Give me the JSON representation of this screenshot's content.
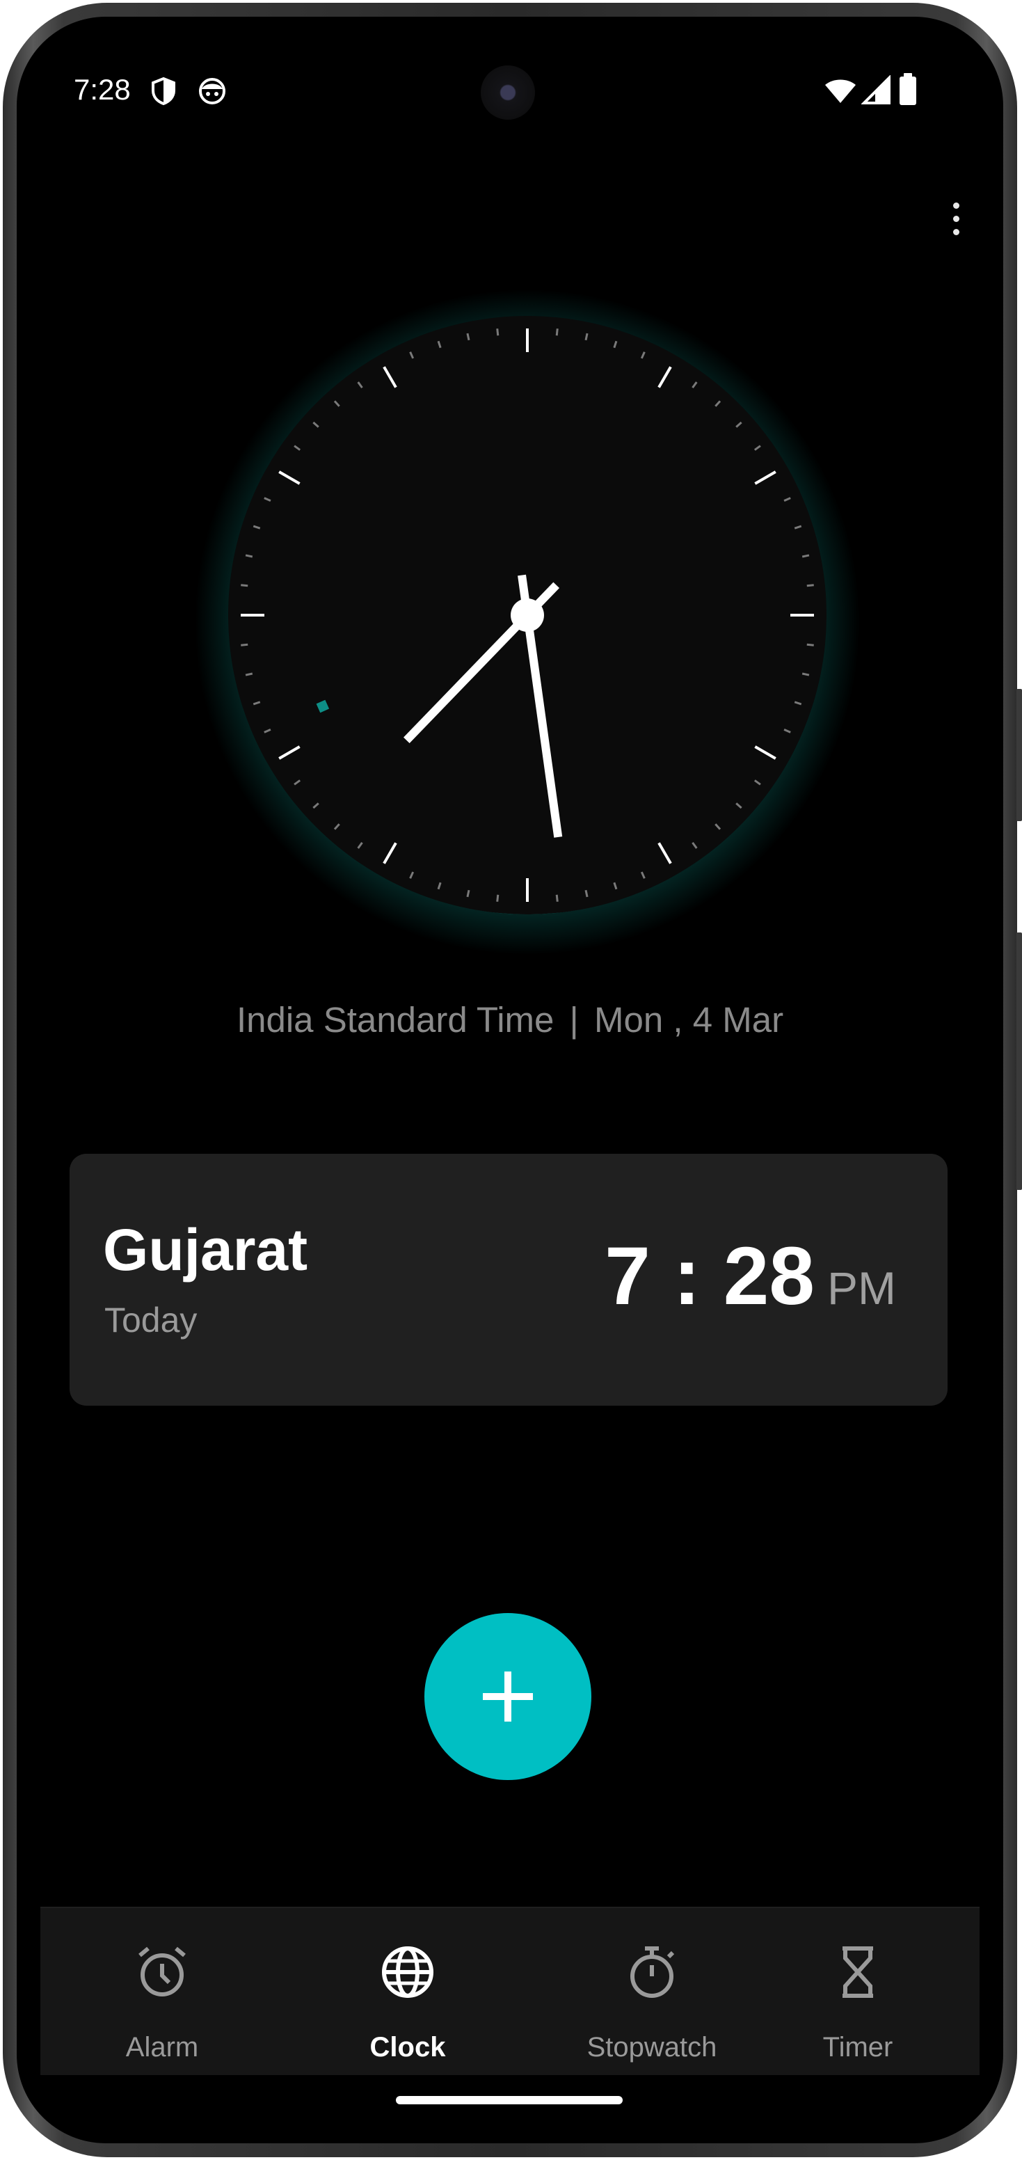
{
  "status_bar": {
    "time": "7:28",
    "left_icons": [
      "shield-icon",
      "face-icon"
    ],
    "right_icons": [
      "wifi-icon",
      "cellular-signal-icon",
      "battery-icon"
    ]
  },
  "toolbar": {
    "menu_icon": "more-vert-icon"
  },
  "analog_clock": {
    "hour": 7,
    "minute": 28,
    "second": 41,
    "accent_color": "#0e8e86"
  },
  "timezone_line": {
    "zone": "India Standard Time",
    "separator": "|",
    "date": "Mon , 4 Mar"
  },
  "world_clocks": [
    {
      "city": "Gujarat",
      "day": "Today",
      "time": "7 : 28",
      "ampm": "PM"
    }
  ],
  "fab": {
    "icon": "plus-icon",
    "color": "#00bfc3"
  },
  "bottom_nav": {
    "items": [
      {
        "label": "Alarm",
        "icon": "alarm-clock-icon",
        "active": false
      },
      {
        "label": "Clock",
        "icon": "globe-icon",
        "active": true
      },
      {
        "label": "Stopwatch",
        "icon": "stopwatch-icon",
        "active": false
      },
      {
        "label": "Timer",
        "icon": "hourglass-icon",
        "active": false
      }
    ]
  }
}
